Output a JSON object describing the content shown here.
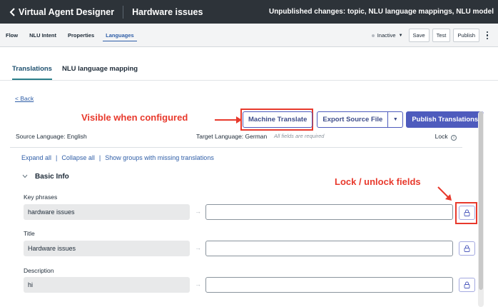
{
  "header": {
    "app_title": "Virtual Agent Designer",
    "topic_title": "Hardware issues",
    "unpublished": "Unpublished changes: topic, NLU language mappings, NLU model"
  },
  "subtabs": [
    {
      "label": "Flow"
    },
    {
      "label": "NLU Intent"
    },
    {
      "label": "Properties"
    },
    {
      "label": "Languages"
    }
  ],
  "actions": {
    "status": "Inactive",
    "save": "Save",
    "test": "Test",
    "publish": "Publish"
  },
  "lang_tabs": {
    "translations": "Translations",
    "nlu_mapping": "NLU language mapping"
  },
  "back_link": "< Back",
  "callouts": {
    "visible": "Visible when configured",
    "lock": "Lock / unlock fields"
  },
  "buttons": {
    "machine_translate": "Machine Translate",
    "export_source": "Export Source File",
    "publish_translations": "Publish Translations"
  },
  "language_row": {
    "source": "Source Language: English",
    "target": "Target Language: German",
    "required_note": "All fields are required",
    "lock": "Lock"
  },
  "links": {
    "expand_all": "Expand all",
    "collapse_all": "Collapse all",
    "show_missing": "Show groups with missing translations",
    "separator": "|"
  },
  "group": {
    "title": "Basic Info"
  },
  "fields": [
    {
      "label": "Key phrases",
      "source": "hardware issues",
      "target": ""
    },
    {
      "label": "Title",
      "source": "Hardware issues",
      "target": ""
    },
    {
      "label": "Description",
      "source": "hi",
      "target": ""
    }
  ],
  "colors": {
    "topbar": "#2d3339",
    "accent": "#4e5bbd",
    "callout": "#e8392c",
    "link": "#2f5ea7"
  }
}
